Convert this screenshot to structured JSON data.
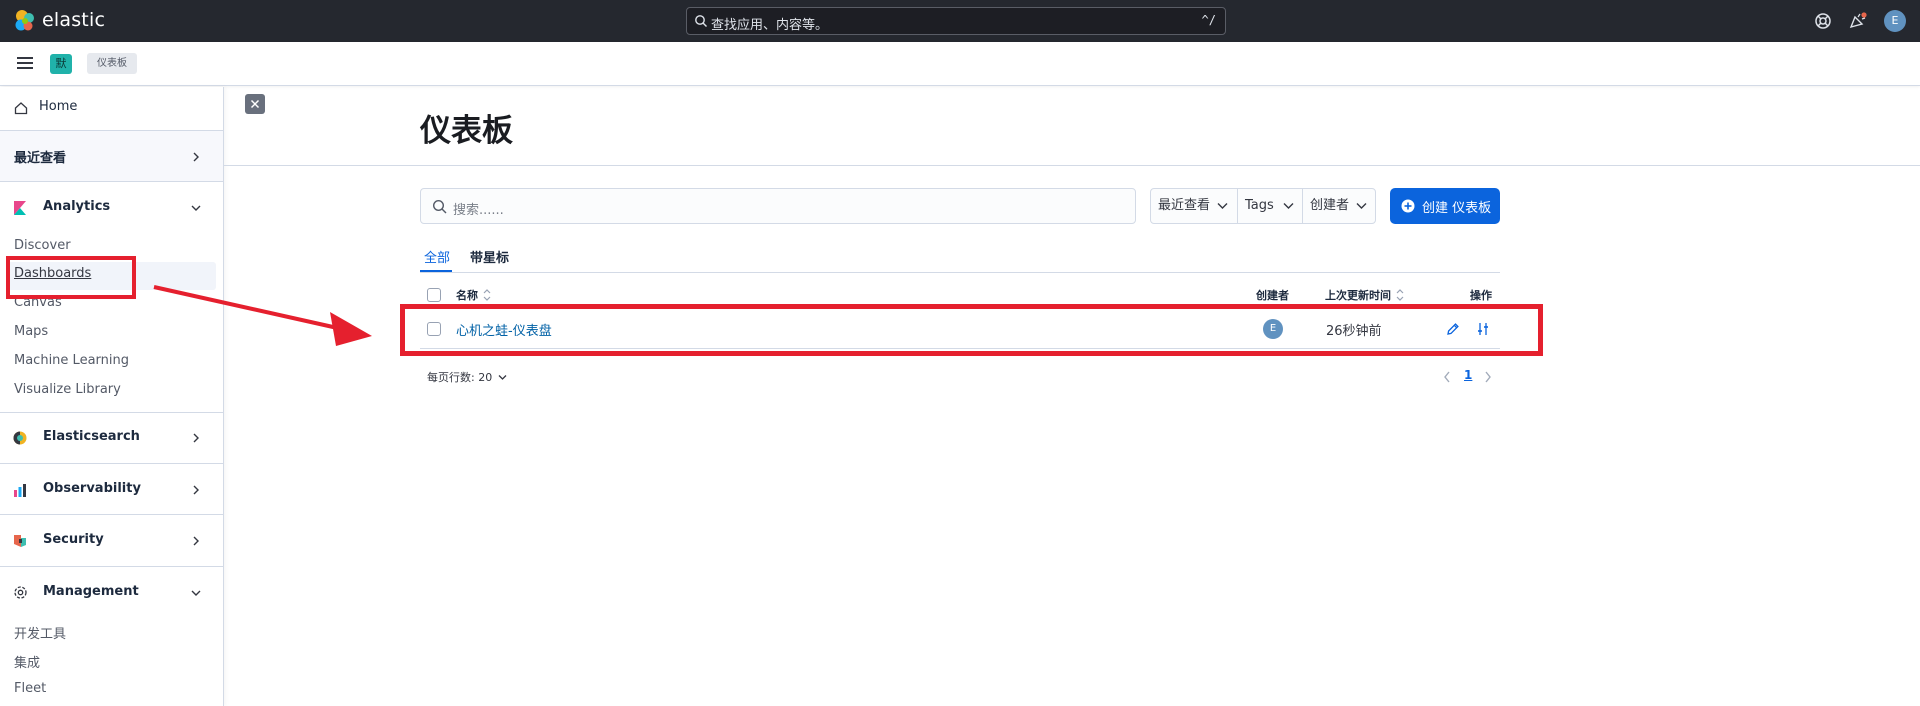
{
  "app": {
    "logo_text": "elastic"
  },
  "global_search": {
    "placeholder": "查找应用、内容等。",
    "shortcut": "^/"
  },
  "user": {
    "initial": "E"
  },
  "space": {
    "initial": "默"
  },
  "breadcrumb": {
    "current": "仪表板"
  },
  "sidebar": {
    "home": "Home",
    "recent": "最近查看",
    "analytics": {
      "label": "Analytics",
      "items": [
        "Discover",
        "Dashboards",
        "Canvas",
        "Maps",
        "Machine Learning",
        "Visualize Library"
      ]
    },
    "elasticsearch": "Elasticsearch",
    "observability": "Observability",
    "security": "Security",
    "management": {
      "label": "Management",
      "items": [
        "开发工具",
        "集成",
        "Fleet"
      ]
    }
  },
  "page": {
    "title": "仪表板",
    "search_placeholder": "搜索......",
    "filters": {
      "sort": "最近查看",
      "tags": "Tags",
      "creator": "创建者"
    },
    "create_button": "创建 仪表板",
    "tabs": [
      "全部",
      "带星标"
    ],
    "table": {
      "headers": {
        "name": "名称",
        "creator": "创建者",
        "updated": "上次更新时间",
        "actions": "操作"
      },
      "rows": [
        {
          "name": "心机之蛙-仪表盘",
          "creator_initial": "E",
          "updated": "26秒钟前"
        }
      ]
    },
    "pagination": {
      "rows_per_page": "每页行数: 20",
      "current_page": "1"
    }
  },
  "colors": {
    "accent": "#0b64dd",
    "topbar": "#25282f",
    "annotation": "#e5202e"
  }
}
